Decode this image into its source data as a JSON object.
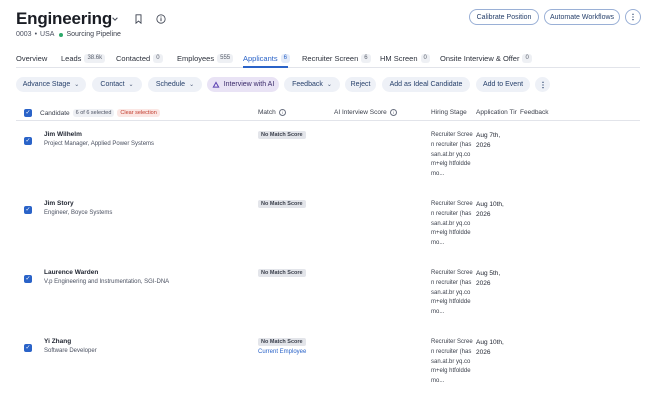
{
  "header": {
    "title": "Engineering",
    "job_id": "0003",
    "location": "USA",
    "pipeline": "Sourcing Pipeline",
    "calibrate_label": "Calibrate Position",
    "automate_label": "Automate Workflows",
    "more_label": "⋮"
  },
  "tabs": [
    {
      "label": "Overview",
      "count": ""
    },
    {
      "label": "Leads",
      "count": "38.6k"
    },
    {
      "label": "Contacted",
      "count": "0"
    },
    {
      "label": "Employees",
      "count": "555"
    },
    {
      "label": "Applicants",
      "count": "6"
    },
    {
      "label": "Recruiter Screen",
      "count": "6"
    },
    {
      "label": "HM Screen",
      "count": "0"
    },
    {
      "label": "Onsite Interview & Offer",
      "count": "0"
    }
  ],
  "active_tab": "Applicants",
  "actions": {
    "advance_stage": "Advance Stage",
    "contact": "Contact",
    "schedule": "Schedule",
    "interview_ai": "Interview with AI",
    "feedback": "Feedback",
    "reject": "Reject",
    "add_ideal": "Add as Ideal Candidate",
    "add_event": "Add to Event",
    "more": "⋮"
  },
  "table": {
    "columns": {
      "candidate": "Candidate",
      "selected_badge": "6 of 6 selected",
      "clear_selection": "Clear selection",
      "match": "Match",
      "ai_score": "AI Interview Score",
      "hiring_stage": "Hiring Stage",
      "application_time": "Application Tir",
      "feedback": "Feedback"
    },
    "rows": [
      {
        "name": "Jim Wilhelm",
        "role": "Project Manager, Applied Power Systems",
        "match": "No Match Score",
        "tag": "",
        "stage": "Recruiter Screen recruiter (hassan.at.br yq.com+elg htfolddemo...",
        "date": "Aug 7th, 2026"
      },
      {
        "name": "Jim Story",
        "role": "Engineer, Boyce Systems",
        "match": "No Match Score",
        "tag": "",
        "stage": "Recruiter Screen recruiter (hassan.at.br yq.com+elg htfolddemo...",
        "date": "Aug 10th, 2026"
      },
      {
        "name": "Laurence Warden",
        "role": "V.p Engineering and Instrumentation, SGI-DNA",
        "match": "No Match Score",
        "tag": "",
        "stage": "Recruiter Screen recruiter (hassan.at.br yq.com+elg htfolddemo...",
        "date": "Aug 5th, 2026"
      },
      {
        "name": "Yi Zhang",
        "role": "Software Developer",
        "match": "No Match Score",
        "tag": "Current Employee",
        "stage": "Recruiter Screen recruiter (hassan.at.br yq.com+elg htfolddemo...",
        "date": "Aug 10th, 2026"
      }
    ]
  },
  "colors": {
    "accent": "#2a63c8",
    "status_green": "#2ea86a",
    "ai_button_bg": "#e9e3f5",
    "clear_red": "#c0392b"
  },
  "icons": {
    "chevron": "chevron-down-icon",
    "bookmark": "bookmark-icon",
    "info": "info-icon",
    "more": "more-vertical-icon",
    "checkbox": "checkbox-checked-icon",
    "ai": "ai-logo-icon"
  }
}
